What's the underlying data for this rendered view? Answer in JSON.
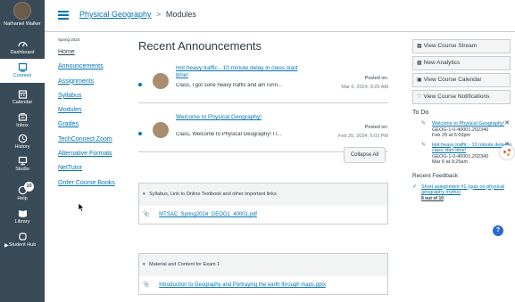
{
  "global_nav": {
    "user": "Nathaniel Walker",
    "items": [
      {
        "label": "Dashboard",
        "icon": "dashboard-icon"
      },
      {
        "label": "Courses",
        "icon": "courses-icon"
      },
      {
        "label": "Calendar",
        "icon": "calendar-icon"
      },
      {
        "label": "Inbox",
        "icon": "inbox-icon"
      },
      {
        "label": "History",
        "icon": "history-icon"
      },
      {
        "label": "Studio",
        "icon": "studio-icon"
      },
      {
        "label": "Help",
        "icon": "help-icon"
      },
      {
        "label": "Library",
        "icon": "library-icon"
      },
      {
        "label": "Student Hub",
        "icon": "student-hub-icon"
      }
    ],
    "help_badge": "10",
    "active_color": "#0374b5",
    "bg_color": "#394b58"
  },
  "header": {
    "course": "Physical Geography",
    "separator": ">",
    "page": "Modules"
  },
  "course_nav": {
    "term": "Spring 2024",
    "items": [
      "Home",
      "Announcements",
      "Assignments",
      "Syllabus",
      "Modules",
      "Grades",
      "TechConnect Zoom",
      "Alternative Formats",
      "NetTutor",
      "Order Course Books"
    ]
  },
  "main": {
    "title": "Recent Announcements",
    "announcements": [
      {
        "title": "Hot heavy traffic - 10 minute delay in class start time!",
        "snippet": "Class, I got sone heavy traffic and am runn...",
        "posted_label": "Posted on:",
        "date": "Mar 6, 2024, 9:25 AM"
      },
      {
        "title": "Welcome to Physical Geography!",
        "snippet": "Class,  Welcome to Physical Geography! I l...",
        "posted_label": "Posted on:",
        "date": "Feb 25, 2024, 5:03 PM"
      }
    ],
    "collapse_all": "Collapse All",
    "modules": [
      {
        "title": "Syllabus, Link to Online Textbook and other important links",
        "items": [
          "MTSAC_Spring2024_GEOG1_40001.pdf"
        ]
      },
      {
        "title": "Material and Content for Exam 1",
        "items": [
          "Introduction to Geography and Portraying the earth through maps.pptx"
        ]
      }
    ]
  },
  "sidebar": {
    "buttons": [
      "View Course Stream",
      "New Analytics",
      "View Course Calendar",
      "View Course Notifications"
    ],
    "todo_title": "To Do",
    "todos": [
      {
        "title": "Welcome to Physical Geography!",
        "course": "GEOG-1-0-40001.202340",
        "date": "Feb 25 at 5:03pm"
      },
      {
        "title": "Hot heavy traffic - 10 minute delay in class start time!",
        "course": "GEOG-1-0-40001.202340",
        "date": "Mar 6 at 9:25am"
      }
    ],
    "feedback_title": "Recent Feedback",
    "feedback": [
      {
        "title": "Short assignment #1 (quiz on physical geography myths)",
        "score": "8 out of 10"
      }
    ]
  }
}
